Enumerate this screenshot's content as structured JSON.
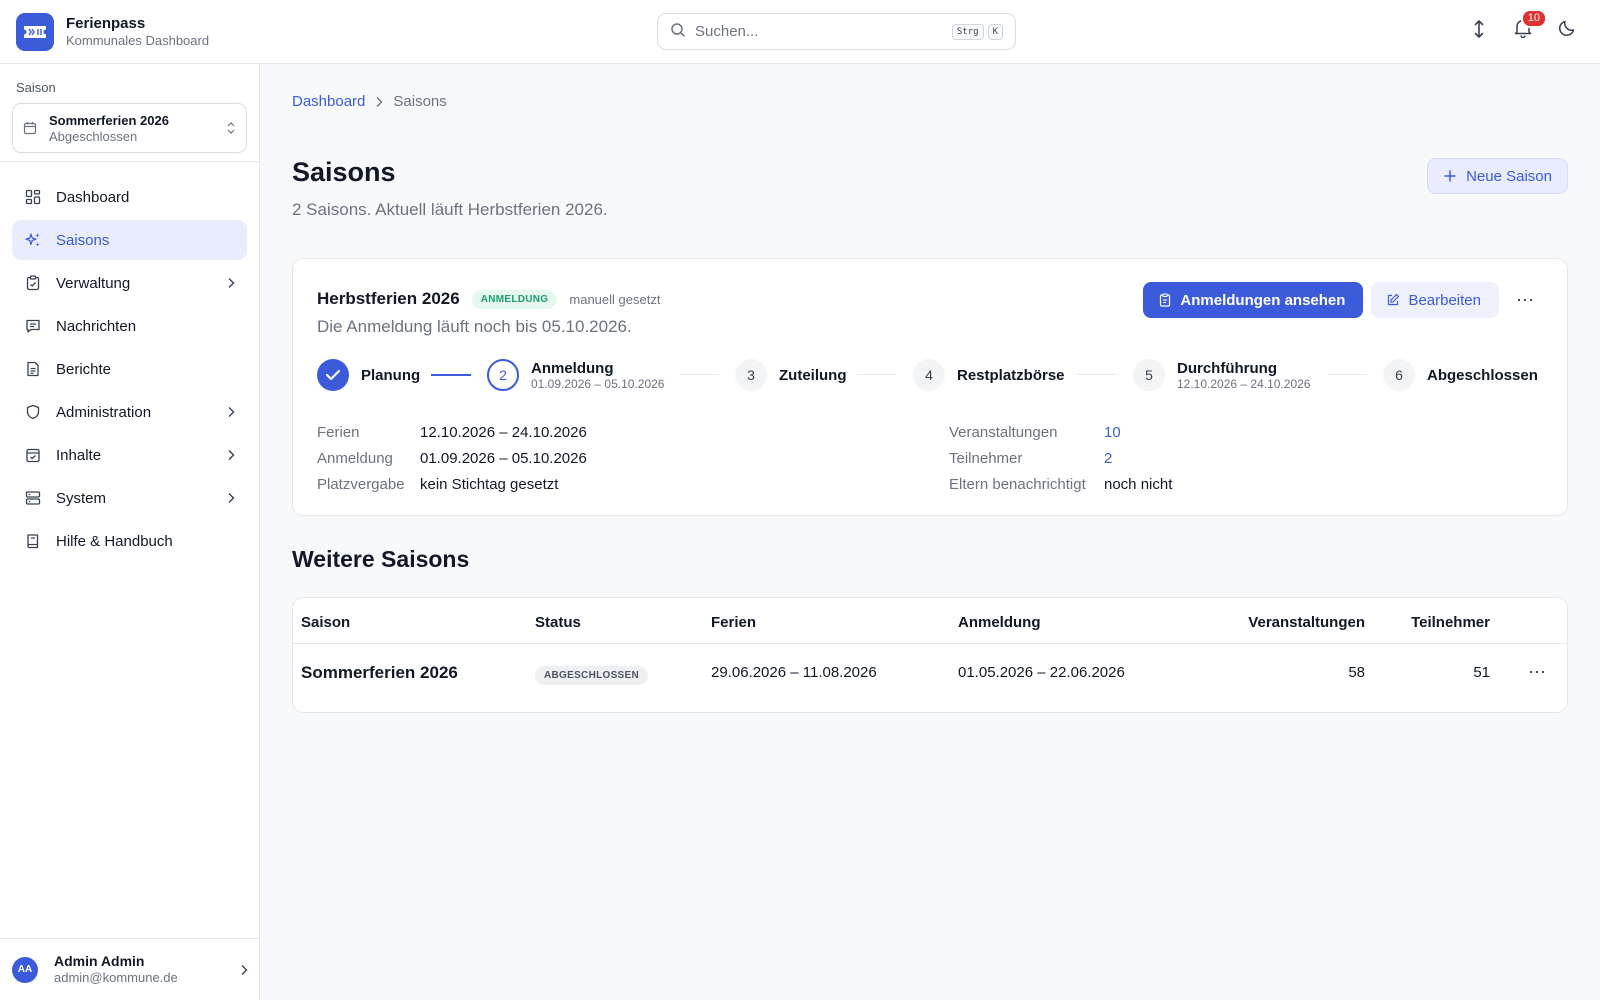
{
  "app": {
    "title": "Ferienpass",
    "subtitle": "Kommunales Dashboard"
  },
  "search": {
    "placeholder": "Suchen...",
    "value": "",
    "shortcut_key1": "Strg",
    "shortcut_key2": "K"
  },
  "header": {
    "notification_count": "10"
  },
  "sidebar": {
    "season_label": "Saison",
    "season_select": {
      "name": "Sommerferien 2026",
      "state": "Abgeschlossen"
    },
    "items": [
      {
        "label": "Dashboard",
        "icon": "dashboard-icon"
      },
      {
        "label": "Saisons",
        "icon": "sparkles-icon"
      },
      {
        "label": "Verwaltung",
        "icon": "clipboard-icon"
      },
      {
        "label": "Nachrichten",
        "icon": "message-icon"
      },
      {
        "label": "Berichte",
        "icon": "report-icon"
      },
      {
        "label": "Administration",
        "icon": "shield-icon"
      },
      {
        "label": "Inhalte",
        "icon": "calendar-check-icon"
      },
      {
        "label": "System",
        "icon": "server-icon"
      },
      {
        "label": "Hilfe & Handbuch",
        "icon": "book-icon"
      }
    ],
    "user": {
      "initials": "AA",
      "name": "Admin Admin",
      "email": "admin@kommune.de"
    }
  },
  "breadcrumb": {
    "root": "Dashboard",
    "current": "Saisons"
  },
  "page": {
    "title": "Saisons",
    "subtitle": "2 Saisons. Aktuell läuft Herbstferien 2026.",
    "new_button": "Neue Saison"
  },
  "current_season": {
    "title": "Herbstferien 2026",
    "status": "ANMELDUNG",
    "status_note": "manuell gesetzt",
    "description": "Die Anmeldung läuft noch bis 05.10.2026.",
    "actions": {
      "primary": "Anmeldungen ansehen",
      "edit": "Bearbeiten"
    },
    "steps": [
      {
        "number": "1",
        "label": "Planung",
        "dates": ""
      },
      {
        "number": "2",
        "label": "Anmeldung",
        "dates": "01.09.2026 – 05.10.2026"
      },
      {
        "number": "3",
        "label": "Zuteilung",
        "dates": ""
      },
      {
        "number": "4",
        "label": "Restplatzbörse",
        "dates": ""
      },
      {
        "number": "5",
        "label": "Durchführung",
        "dates": "12.10.2026 – 24.10.2026"
      },
      {
        "number": "6",
        "label": "Abgeschlossen",
        "dates": ""
      }
    ],
    "details_left": [
      {
        "key": "Ferien",
        "value": "12.10.2026 – 24.10.2026"
      },
      {
        "key": "Anmeldung",
        "value": "01.09.2026 – 05.10.2026"
      },
      {
        "key": "Platzvergabe",
        "value": "kein Stichtag gesetzt"
      }
    ],
    "details_right": [
      {
        "key": "Veranstaltungen",
        "value": "10"
      },
      {
        "key": "Teilnehmer",
        "value": "2"
      },
      {
        "key": "Eltern benachrichtigt",
        "value": "noch nicht"
      }
    ]
  },
  "other_seasons": {
    "title": "Weitere Saisons",
    "columns": [
      "Saison",
      "Status",
      "Ferien",
      "Anmeldung",
      "Veranstaltungen",
      "Teilnehmer"
    ],
    "rows": [
      {
        "saison": "Sommerferien 2026",
        "status": "ABGESCHLOSSEN",
        "ferien": "29.06.2026 – 11.08.2026",
        "anmeldung": "01.05.2026 – 22.06.2026",
        "veranstaltungen": "58",
        "teilnehmer": "51"
      }
    ]
  },
  "colors": {
    "accent": "#3b5bdb",
    "success": "#17a06a",
    "danger": "#e03131"
  }
}
